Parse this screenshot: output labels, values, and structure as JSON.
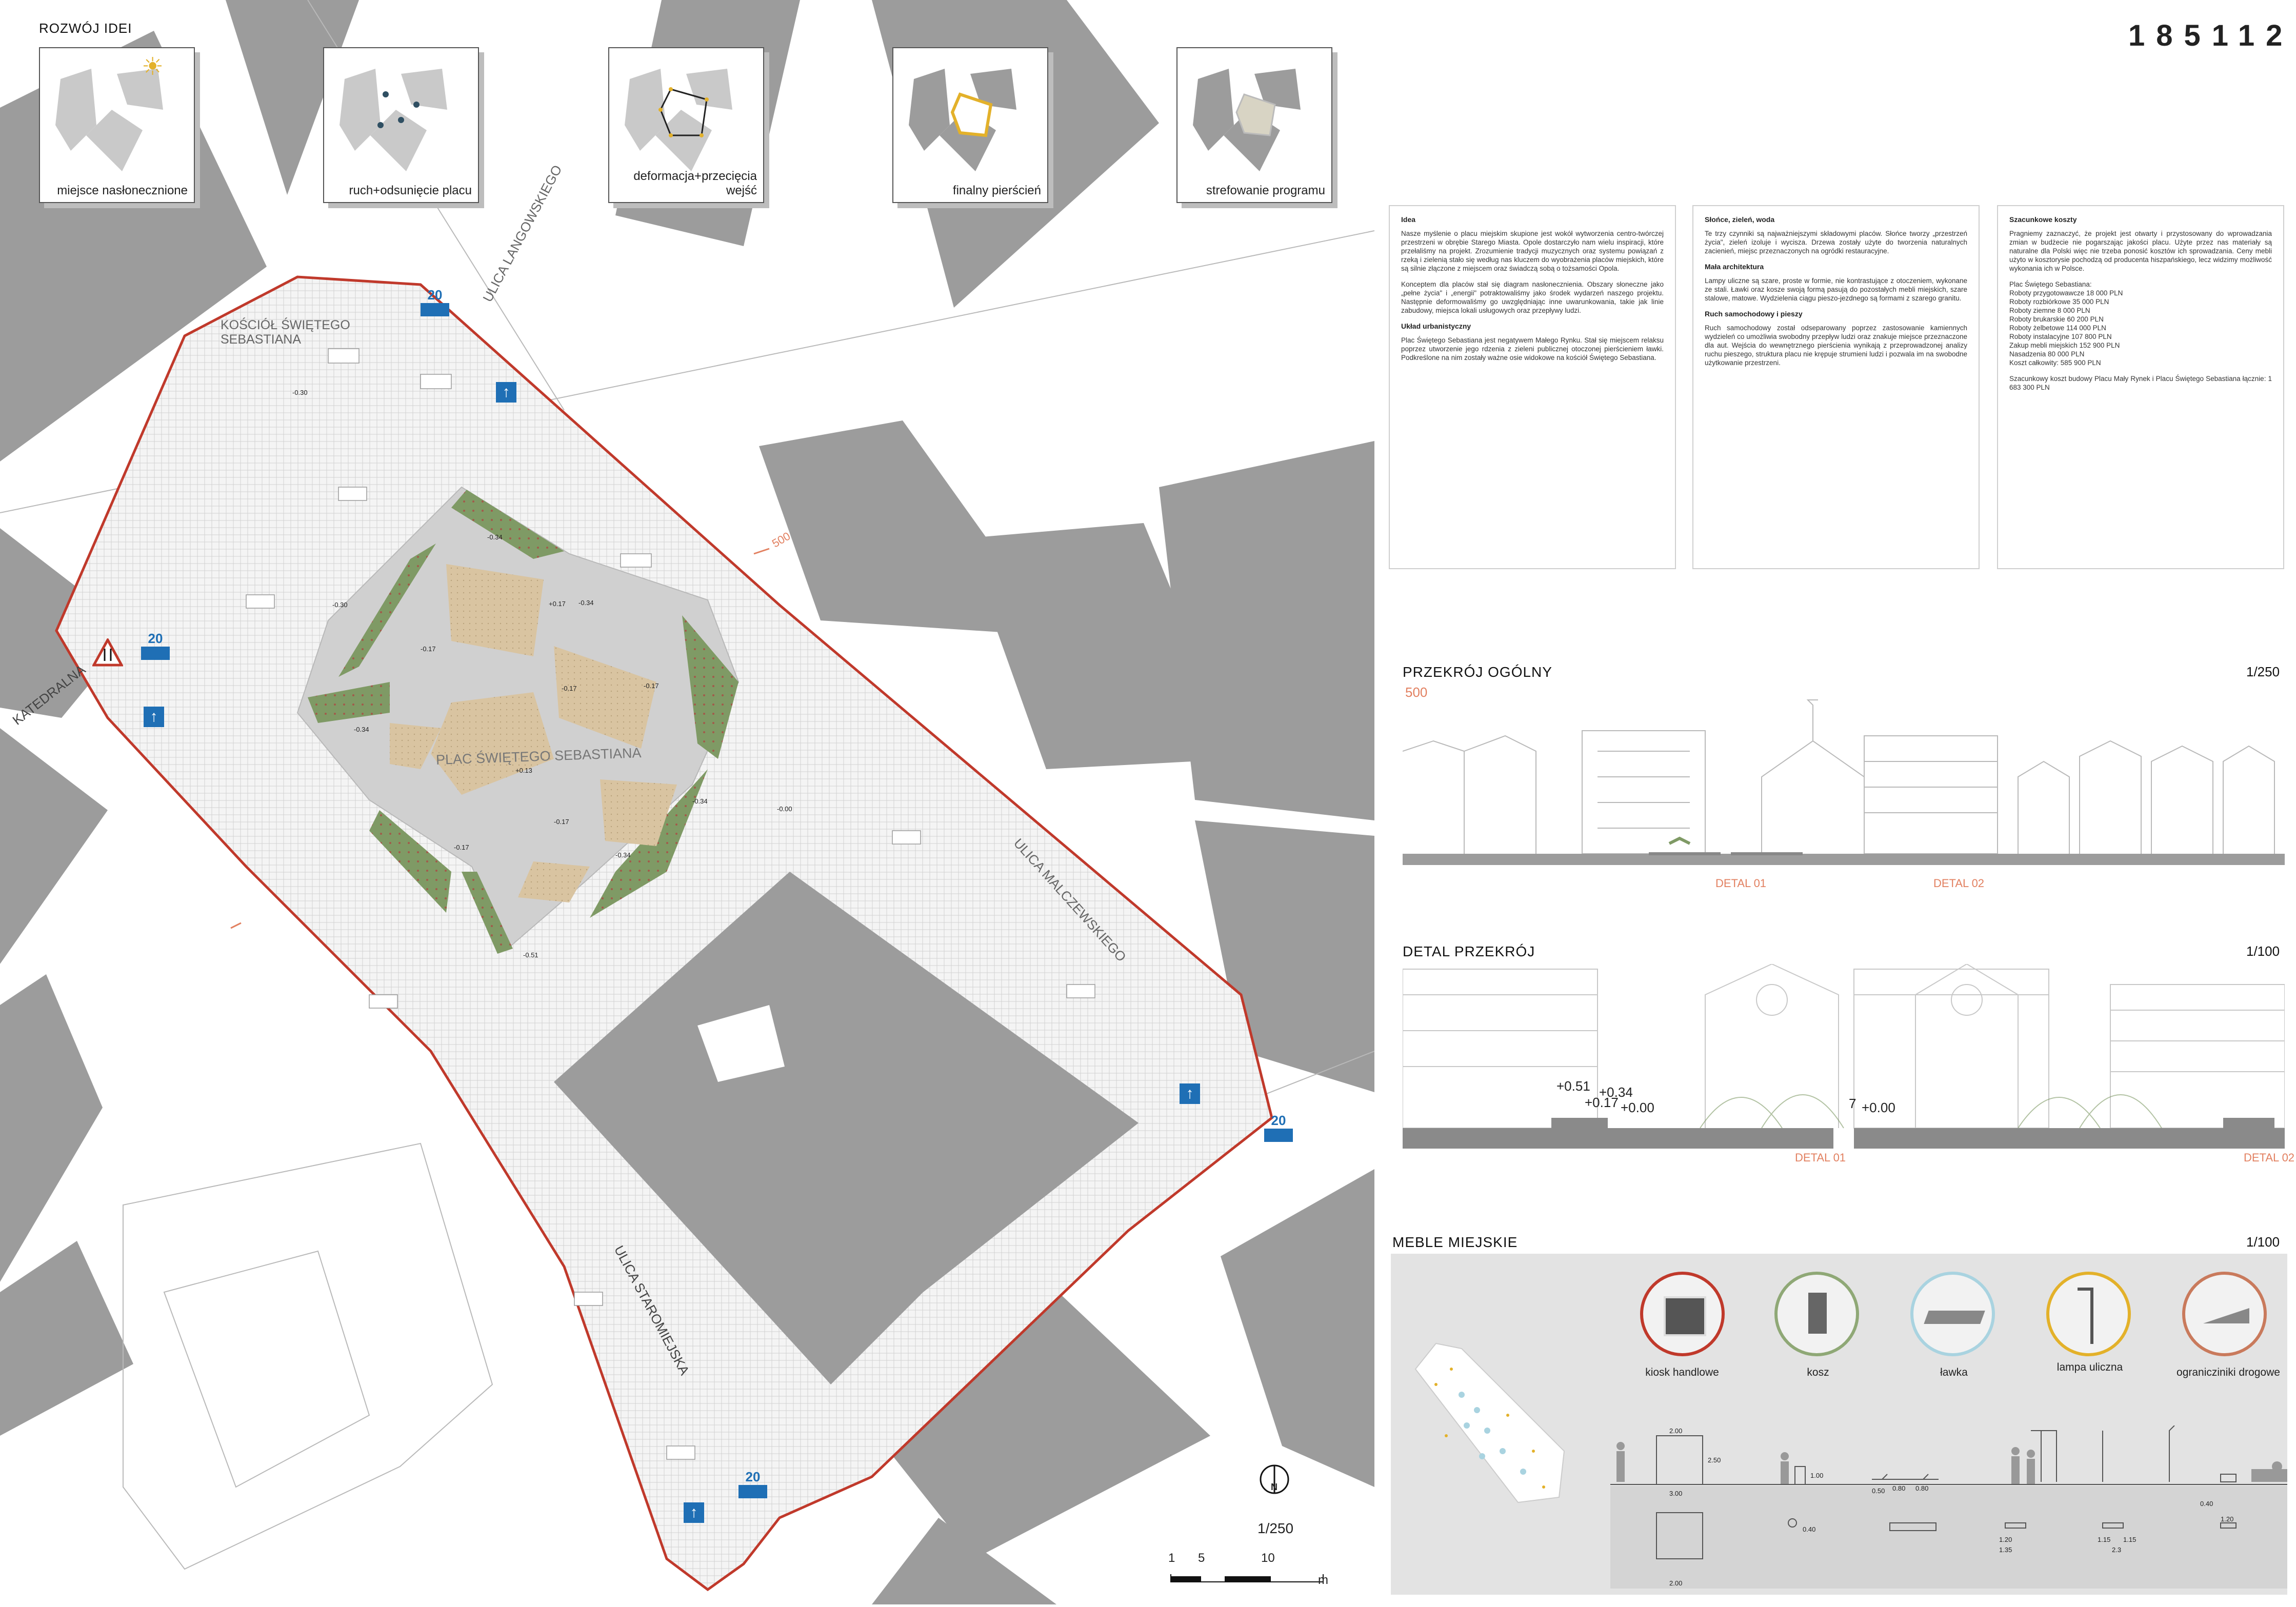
{
  "project_code": "185112",
  "idea_section": {
    "title": "ROZWÓJ IDEI",
    "steps": [
      {
        "label": "miejsce nasłonecznione",
        "icon": "sun-icon"
      },
      {
        "label": "ruch+odsunięcie placu"
      },
      {
        "label": "deformacja+przecięcia wejść"
      },
      {
        "label": "finalny pierścień"
      },
      {
        "label": "strefowanie programu"
      }
    ]
  },
  "map": {
    "labels": {
      "church": "KOŚCIÓŁ ŚWIĘTEGO SEBASTIANA",
      "square": "PLAC ŚWIĘTEGO SEBASTIANA",
      "street_langowski": "ULICA LANGOWSKIEGO",
      "street_katedralna": "KATEDRALNA",
      "street_malczewski": "ULICA MALCZEWSKIEGO",
      "street_staromiejska": "ULICA STAROMIEJSKA",
      "section_mark": "500"
    },
    "speed_limit": "20",
    "elevations": [
      "-0.30",
      "-0.34",
      "-0.17",
      "-0.17",
      "-0.34",
      "-0.34",
      "-0.17",
      "-0.51",
      "-0.34",
      "-0.17",
      "-0.00",
      "+0.13",
      "+0.17",
      "-0.34",
      "-0.17",
      "-0.30"
    ],
    "north": "N",
    "scale_ratio": "1/250",
    "scale_bar": {
      "ticks": [
        "1",
        "5",
        "10"
      ],
      "unit": "m"
    }
  },
  "text_columns": {
    "col1": {
      "h1": "Idea",
      "p1": "Nasze myślenie o placu miejskim skupione jest wokół wytworzenia centro-twórczej przestrzeni w obrębie Starego Miasta. Opole dostarczyło nam wielu inspiracji, które przełaliśmy na projekt. Zrozumienie tradycji muzycznych oraz systemu powiązań z rzeką i zielenią stało się według nas kluczem do wyobrażenia placów miejskich, które są silnie złączone z miejscem oraz świadczą sobą o tożsamości Opola.",
      "p2": "Konceptem dla placów stał się diagram nasłonecznienia. Obszary słoneczne jako „pełne życia\" i „energii\" potraktowaliśmy jako środek wydarzeń naszego projektu. Następnie deformowaliśmy go uwzględniając inne uwarunkowania, takie jak linie zabudowy, miejsca lokali usługowych oraz przepływy ludzi.",
      "h2": "Układ urbanistyczny",
      "p3": "Plac Świętego Sebastiana jest negatywem Małego Rynku. Stał się miejscem relaksu poprzez utworzenie jego rdzenia z zieleni publicznej otoczonej pierścieniem ławki. Podkreślone na nim zostały ważne osie widokowe na kościół Świętego Sebastiana."
    },
    "col2": {
      "h1": "Słońce, zieleń, woda",
      "p1": "Te trzy czynniki są najważniejszymi składowymi placów. Słońce tworzy „przestrzeń życia\", zieleń izoluje i wycisza. Drzewa zostały użyte do tworzenia naturalnych zacienień, miejsc przeznaczonych na ogródki restauracyjne.",
      "h2": "Mała architektura",
      "p2": "Lampy uliczne są szare, proste w formie, nie kontrastujące z otoczeniem, wykonane ze stali. Ławki oraz kosze swoją formą pasują do pozostałych mebli miejskich, szare stalowe, matowe. Wydzielenia ciągu pieszo-jezdnego są formami z szarego granitu.",
      "h3": "Ruch samochodowy i pieszy",
      "p3": "Ruch samochodowy został odseparowany poprzez zastosowanie kamiennych wydzieleń co umożliwia swobodny przepływ ludzi oraz znakuje miejsce przeznaczone dla aut. Wejścia do wewnętrznego pierścienia wynikają z przeprowadzonej analizy ruchu pieszego, struktura placu nie krępuje strumieni ludzi i pozwala im na swobodne użytkowanie przestrzeni."
    },
    "col3": {
      "h1": "Szacunkowe koszty",
      "p1": "Pragniemy zaznaczyć, że projekt jest otwarty i przystosowany do wprowadzania zmian w budżecie nie pogarszając jakości placu. Użyte przez nas materiały są naturalne dla Polski więc nie trzeba ponosić kosztów ich sprowadzania. Ceny mebli użyto w kosztorysie pochodzą od producenta hiszpańskiego, lecz widzimy możliwość wykonania ich w Polsce.",
      "list_title": "Plac Świętego Sebastiana:",
      "items": [
        "Roboty przygotowawcze 18 000 PLN",
        "Roboty rozbiórkowe 35 000 PLN",
        "Roboty ziemne 8 000 PLN",
        "Roboty brukarskie 60 200 PLN",
        "Roboty żelbetowe 114 000 PLN",
        "Roboty instalacyjne 107 800 PLN",
        "Zakup mebli miejskich 152 900 PLN",
        "Nasadzenia 80 000 PLN",
        "Koszt całkowity: 585 900 PLN"
      ],
      "p2": "Szacunkowy koszt budowy Placu Mały Rynek i Placu Świętego Sebastiana łącznie: 1 683 300 PLN"
    }
  },
  "section_general": {
    "title": "PRZEKRÓJ OGÓLNY",
    "mark": "500",
    "scale": "1/250",
    "detail1": "DETAL 01",
    "detail2": "DETAL 02"
  },
  "section_detail": {
    "title": "DETAL PRZEKRÓJ",
    "scale": "1/100",
    "levels_left": [
      "+0.51",
      "+0.34",
      "+0.17",
      "+0.00"
    ],
    "level_right": "+0.00",
    "mark7": "7",
    "detail1": "DETAL 01",
    "detail2": "DETAL 02"
  },
  "furniture": {
    "title": "MEBLE MIEJSKIE",
    "scale": "1/100",
    "items": [
      {
        "label": "kiosk handlowe",
        "color": "#c0392b"
      },
      {
        "label": "kosz",
        "color": "#8fa876"
      },
      {
        "label": "ławka",
        "color": "#a9d3e0"
      },
      {
        "label": "lampa uliczna",
        "color": "#e3b12a"
      },
      {
        "label": "ogranicziniki drogowe",
        "color": "#c97a5c"
      }
    ],
    "dims": [
      "2.00",
      "2.50",
      "1.00",
      "0.40",
      "0.80",
      "0.80",
      "0.50",
      "1.20",
      "1.35",
      "1.15",
      "1.15",
      "2.3",
      "0.40",
      "1.20",
      "3.00",
      "2.00"
    ]
  },
  "colors": {
    "boundary": "#c0392b",
    "green": "#7f9a65",
    "sand": "#d8c3a0",
    "building": "#9c9c9c",
    "sign_blue": "#1f6fb5",
    "accent_orange": "#e28060"
  }
}
